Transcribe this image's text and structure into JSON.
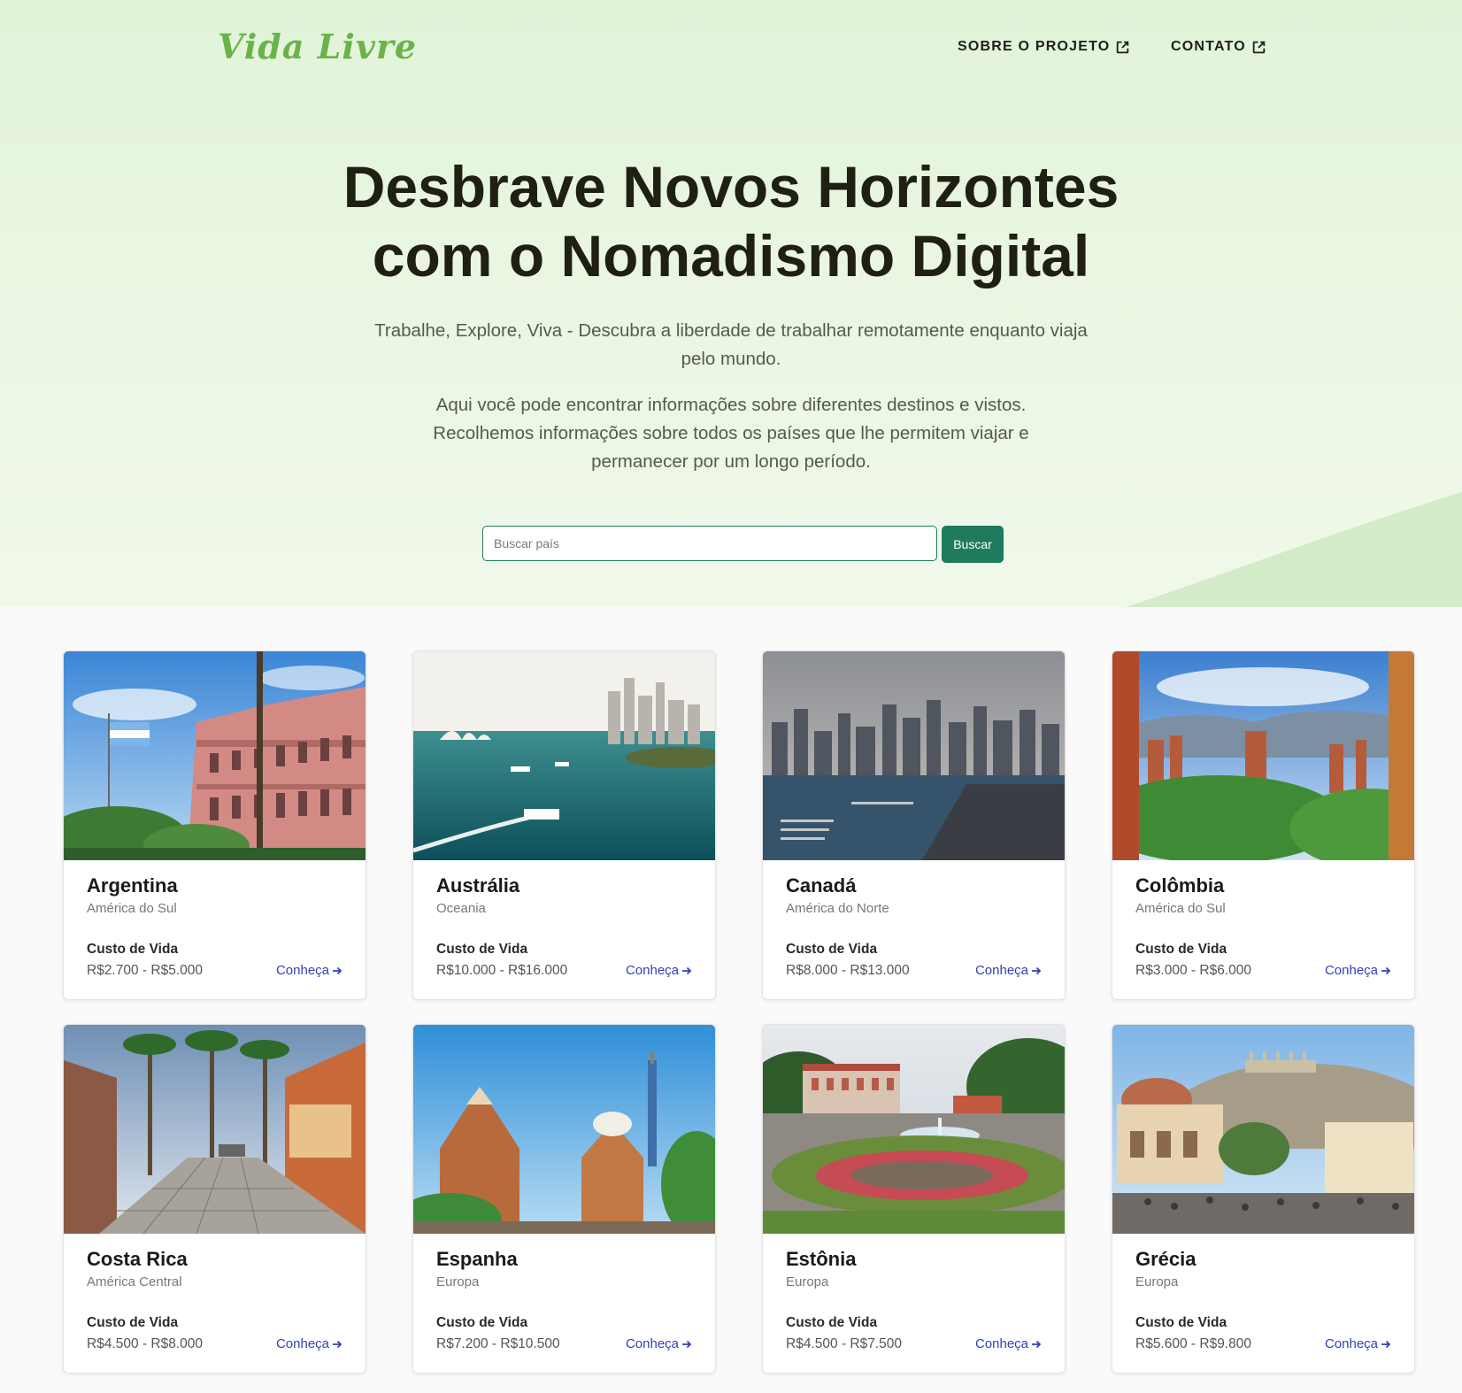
{
  "header": {
    "logo": "Vida Livre",
    "nav": [
      {
        "label": "SOBRE O PROJETO",
        "icon": "external-link-icon"
      },
      {
        "label": "CONTATO",
        "icon": "external-link-icon"
      }
    ]
  },
  "hero": {
    "title_line1": "Desbrave Novos Horizontes",
    "title_line2": "com o Nomadismo Digital",
    "subtitle_line1": "Trabalhe, Explore, Viva - Descubra a liberdade de trabalhar remotamente enquanto viaja",
    "subtitle_line2": "pelo mundo.",
    "desc_line1": "Aqui você pode encontrar informações sobre diferentes destinos e vistos.",
    "desc_line2": "Recolhemos informações sobre todos os países que lhe permitem viajar e",
    "desc_line3": "permanecer por um longo período."
  },
  "search": {
    "placeholder": "Buscar país",
    "button_label": "Buscar"
  },
  "countries": [
    {
      "name": "Argentina",
      "region": "América do Sul",
      "cost_label": "Custo de Vida",
      "cost": "R$2.700 - R$5.000",
      "link": "Conheça"
    },
    {
      "name": "Austrália",
      "region": "Oceania",
      "cost_label": "Custo de Vida",
      "cost": "R$10.000 - R$16.000",
      "link": "Conheça"
    },
    {
      "name": "Canadá",
      "region": "América do Norte",
      "cost_label": "Custo de Vida",
      "cost": "R$8.000 - R$13.000",
      "link": "Conheça"
    },
    {
      "name": "Colômbia",
      "region": "América do Sul",
      "cost_label": "Custo de Vida",
      "cost": "R$3.000 - R$6.000",
      "link": "Conheça"
    },
    {
      "name": "Costa Rica",
      "region": "América Central",
      "cost_label": "Custo de Vida",
      "cost": "R$4.500 - R$8.000",
      "link": "Conheça"
    },
    {
      "name": "Espanha",
      "region": "Europa",
      "cost_label": "Custo de Vida",
      "cost": "R$7.200 - R$10.500",
      "link": "Conheça"
    },
    {
      "name": "Estônia",
      "region": "Europa",
      "cost_label": "Custo de Vida",
      "cost": "R$4.500 - R$7.500",
      "link": "Conheça"
    },
    {
      "name": "Grécia",
      "region": "Europa",
      "cost_label": "Custo de Vida",
      "cost": "R$5.600 - R$9.800",
      "link": "Conheça"
    }
  ],
  "colors": {
    "accent": "#1f7a5e",
    "logo": "#6ab34b",
    "link": "#3440b8",
    "hero_bg": "#e6f5dd"
  }
}
